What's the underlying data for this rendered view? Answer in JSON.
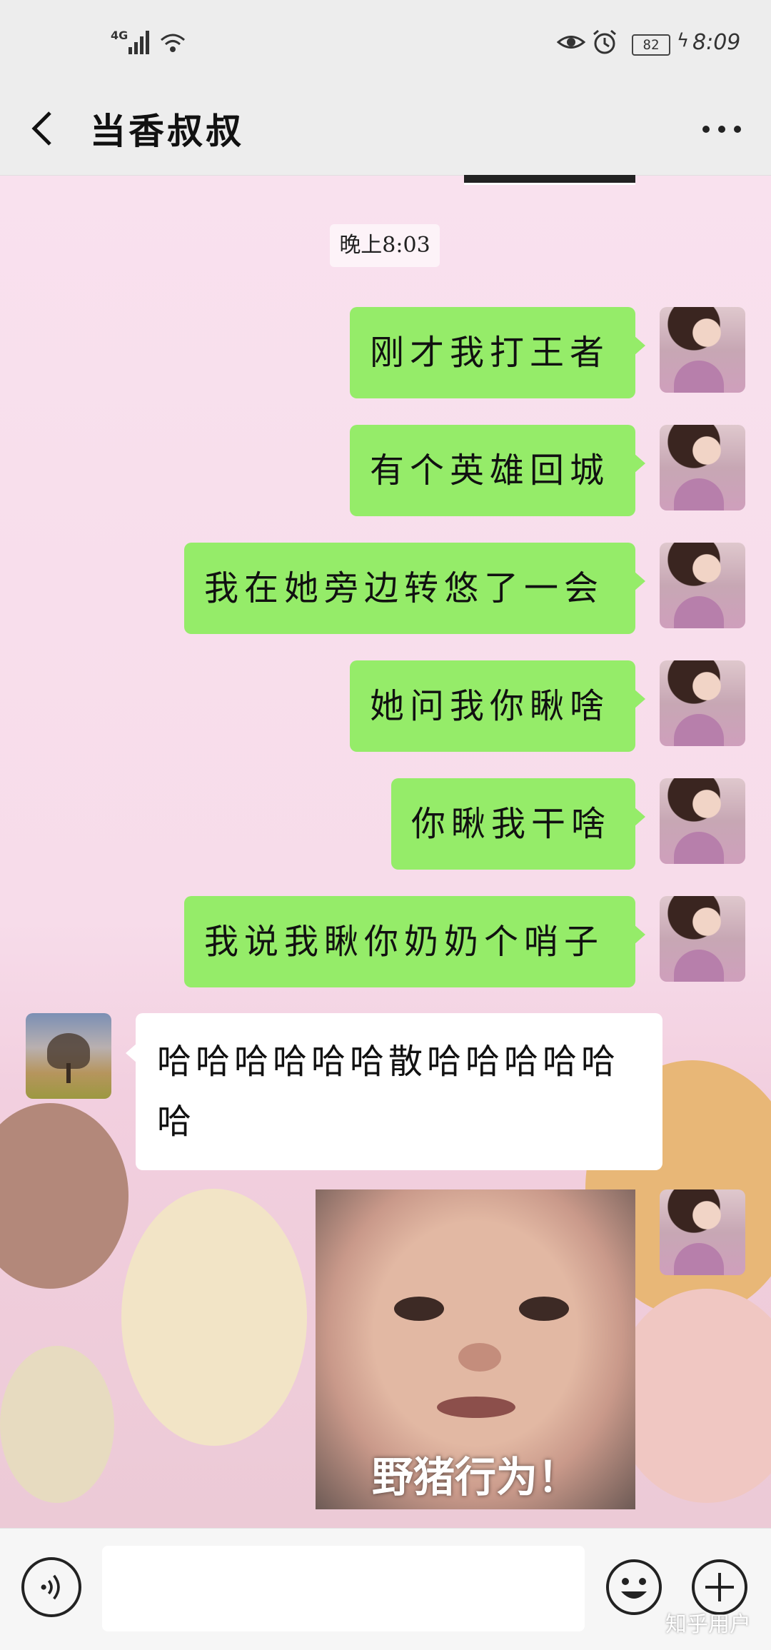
{
  "status_bar": {
    "signal_label": "4G",
    "battery": "82",
    "time": "8:09",
    "icons": [
      "signal-icon",
      "wifi-icon",
      "eye-icon",
      "alarm-icon",
      "battery-icon",
      "charging-icon"
    ]
  },
  "header": {
    "title": "当香叔叔",
    "back_icon": "chevron-left-icon",
    "more_icon": "more-dots-icon"
  },
  "chat": {
    "time_divider": "晚上8:03",
    "messages": [
      {
        "from": "me",
        "text": "刚才我打王者"
      },
      {
        "from": "me",
        "text": "有个英雄回城"
      },
      {
        "from": "me",
        "text": "我在她旁边转悠了一会"
      },
      {
        "from": "me",
        "text": "她问我你瞅啥"
      },
      {
        "from": "me",
        "text": "你瞅我干啥"
      },
      {
        "from": "me",
        "text": "我说我瞅你奶奶个哨子"
      },
      {
        "from": "friend",
        "text": "哈哈哈哈哈哈散哈哈哈哈哈哈"
      },
      {
        "from": "me",
        "type": "sticker",
        "caption": "野猪行为！"
      }
    ]
  },
  "input_bar": {
    "voice_icon": "voice-icon",
    "emoji_icon": "emoji-icon",
    "plus_icon": "plus-icon",
    "input_value": ""
  },
  "watermark": "知乎用户",
  "colors": {
    "bar_bg": "#ededed",
    "my_bubble": "#95ec69",
    "friend_bubble": "#ffffff",
    "wallpaper": "#f7dcea"
  }
}
